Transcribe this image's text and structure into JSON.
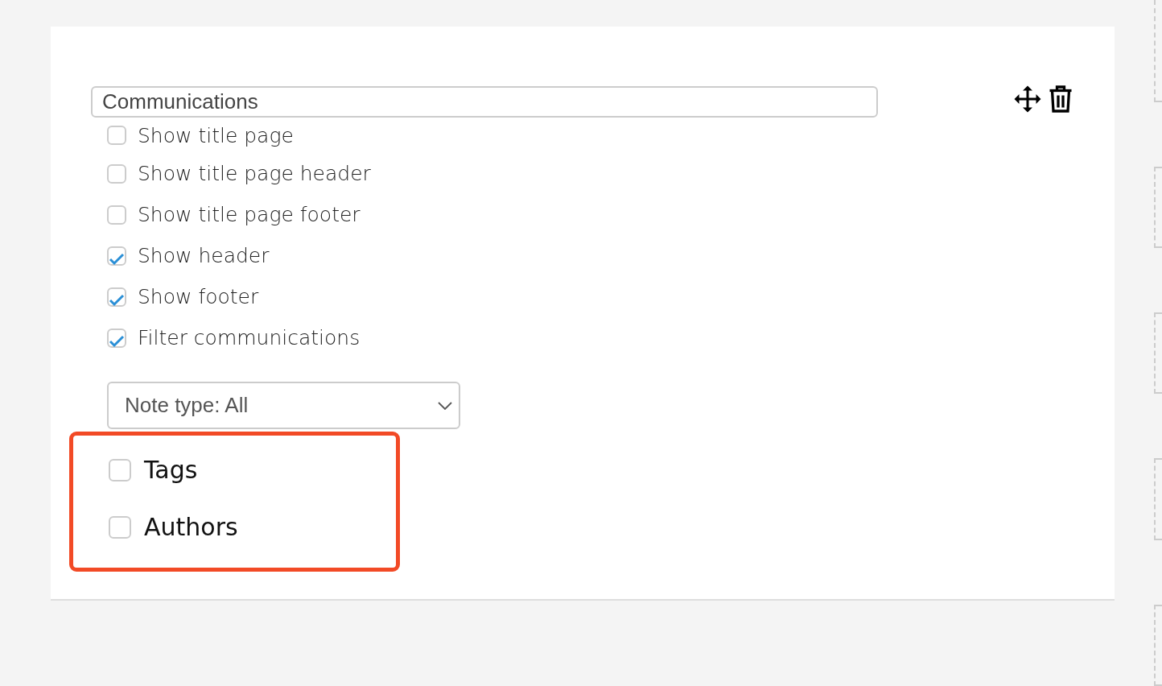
{
  "section": {
    "title_value": "Communications",
    "options": [
      {
        "label": "Show title page",
        "checked": false
      },
      {
        "label": "Show title page header",
        "checked": false
      },
      {
        "label": "Show title page footer",
        "checked": false
      },
      {
        "label": "Show header",
        "checked": true
      },
      {
        "label": "Show footer",
        "checked": true
      },
      {
        "label": "Filter communications",
        "checked": true
      }
    ],
    "note_type_select": {
      "value": "Note type: All"
    },
    "extra_options": {
      "highlighted": true,
      "items": [
        {
          "label": "Tags",
          "checked": false
        },
        {
          "label": "Authors",
          "checked": false
        }
      ]
    }
  }
}
